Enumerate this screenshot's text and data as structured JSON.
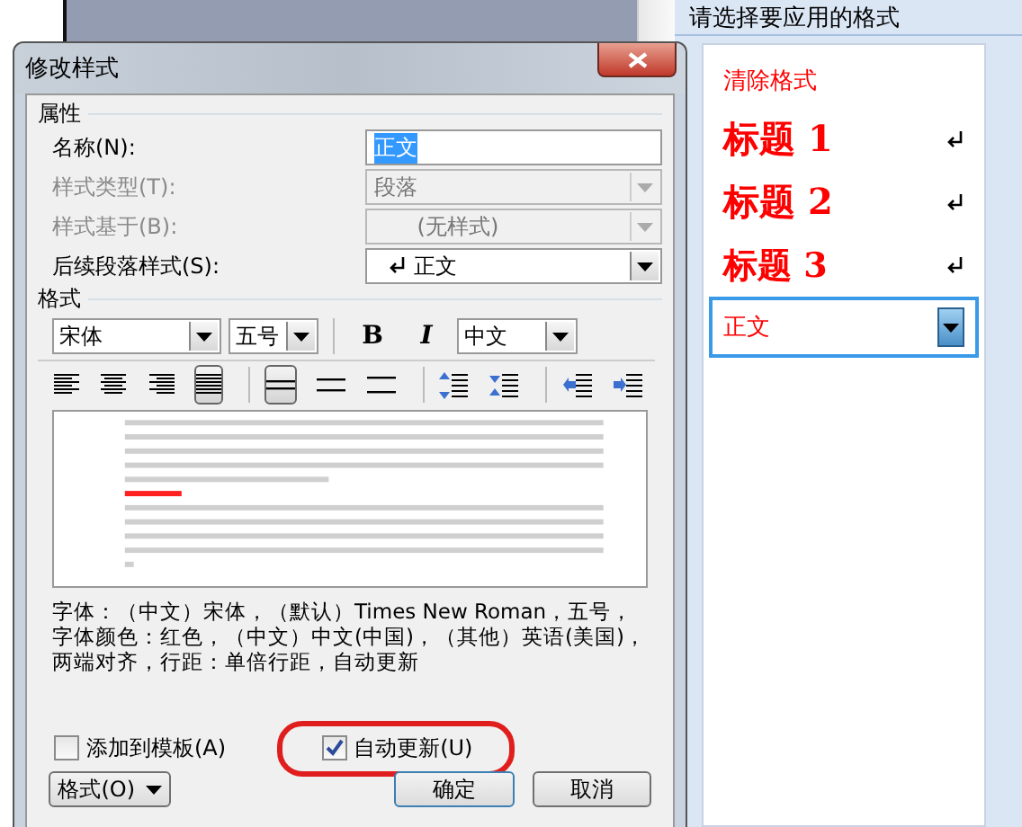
{
  "dialog": {
    "title": "修改样式",
    "properties": {
      "heading": "属性",
      "fields": [
        {
          "label": "名称(N):",
          "value": "正文",
          "kind": "text",
          "disabled": false,
          "selected": true,
          "paragraph_mark": false
        },
        {
          "label": "样式类型(T):",
          "value": "段落",
          "kind": "select",
          "disabled": true,
          "selected": false,
          "paragraph_mark": false
        },
        {
          "label": "样式基于(B):",
          "value": "(无样式)",
          "kind": "select",
          "disabled": true,
          "selected": false,
          "paragraph_mark": false
        },
        {
          "label": "后续段落样式(S):",
          "value": "正文",
          "kind": "select",
          "disabled": false,
          "selected": false,
          "paragraph_mark": true
        }
      ]
    },
    "format": {
      "heading": "格式",
      "font": "宋体",
      "size": "五号",
      "bold": "B",
      "italic": "I",
      "script": "中文",
      "alignment": [
        {
          "kind": "left",
          "selected": false
        },
        {
          "kind": "center",
          "selected": false
        },
        {
          "kind": "right",
          "selected": false
        },
        {
          "kind": "justify",
          "selected": true
        }
      ],
      "spacing": [
        {
          "kind": "single",
          "selected": true
        },
        {
          "kind": "onehalf",
          "selected": false
        },
        {
          "kind": "double",
          "selected": false
        }
      ],
      "paragraph": [
        {
          "kind": "space-up"
        },
        {
          "kind": "space-down"
        },
        {
          "kind": "outdent"
        },
        {
          "kind": "indent"
        }
      ],
      "description": "字体：（中文）宋体，（默认）Times New Roman，五号，字体颜色：红色，（中文）中文(中国)，（其他）英语(美国)，两端对齐，行距：单倍行距，自动更新"
    },
    "checkboxes": [
      {
        "label": "添加到模板(A)",
        "checked": false,
        "circled": false
      },
      {
        "label": "自动更新(U)",
        "checked": true,
        "circled": true
      }
    ],
    "buttons": [
      {
        "label": "格式(O)",
        "kind": "menu"
      },
      {
        "label": "确定",
        "kind": "default"
      },
      {
        "label": "取消",
        "kind": "normal"
      }
    ]
  },
  "styles_pane": {
    "heading": "请选择要应用的格式",
    "items": [
      {
        "label": "清除格式",
        "kind": "clear",
        "paragraph_mark": false,
        "selected": false
      },
      {
        "label": "标题 1",
        "kind": "heading1",
        "paragraph_mark": true,
        "selected": false
      },
      {
        "label": "标题 2",
        "kind": "heading2",
        "paragraph_mark": true,
        "selected": false
      },
      {
        "label": "标题 3",
        "kind": "heading3",
        "paragraph_mark": true,
        "selected": false
      },
      {
        "label": "正文",
        "kind": "body",
        "paragraph_mark": false,
        "selected": true
      }
    ]
  }
}
